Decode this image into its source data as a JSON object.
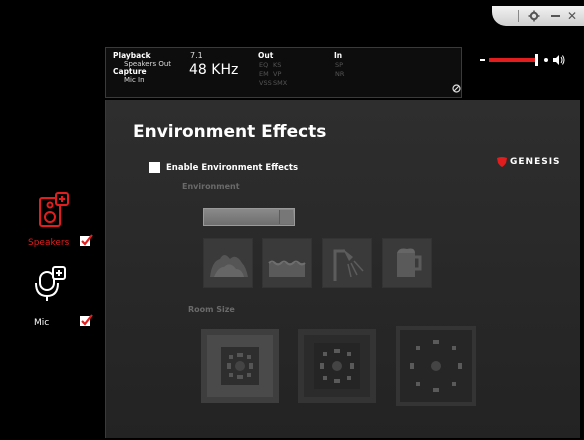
{
  "header": {
    "playback_label": "Playback",
    "playback_sub": "Speakers Out",
    "capture_label": "Capture",
    "capture_sub": "Mic In",
    "channels": "7.1",
    "sample_rate": "48 KHz",
    "out_label": "Out",
    "out_items": [
      "EQ",
      "KS",
      "EM",
      "VP",
      "VSS",
      "SMX"
    ],
    "in_label": "In",
    "in_items": [
      "SP",
      "NR"
    ]
  },
  "volume": {
    "level": 0.87
  },
  "sidebar": {
    "items": [
      {
        "label": "Speakers",
        "checked": true,
        "color": "#e11d1d"
      },
      {
        "label": "Mic",
        "checked": true,
        "color": "#ffffff"
      }
    ]
  },
  "main": {
    "title": "Environment Effects",
    "enable_label": "Enable Environment Effects",
    "environment_label": "Environment",
    "room_size_label": "Room Size",
    "environment_icons": [
      "theater-icon",
      "water-icon",
      "shower-icon",
      "mug-icon"
    ],
    "room_icons": [
      "small-room-icon",
      "medium-room-icon",
      "large-room-icon"
    ]
  },
  "brand": {
    "name": "GENESIS",
    "accent": "#e11d1d"
  }
}
